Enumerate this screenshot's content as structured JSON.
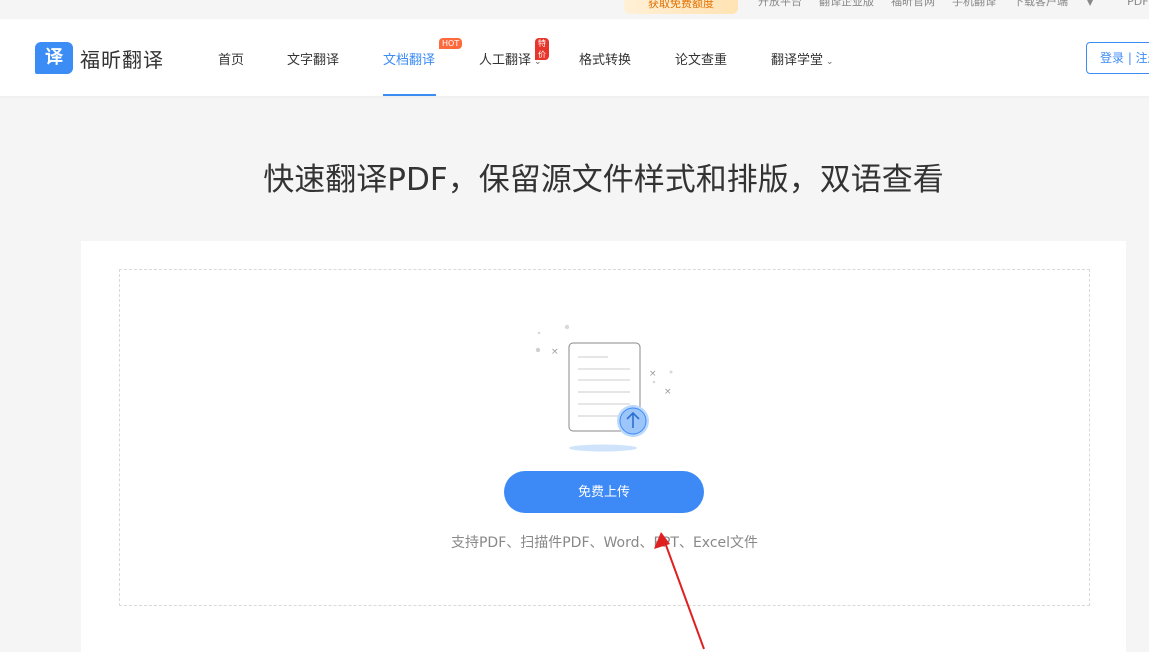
{
  "topbar": {
    "promo": "获取免费额度",
    "links": [
      "开放平台",
      "翻译企业版",
      "福昕官网",
      "手机翻译",
      "下载客户端",
      "PDF在线"
    ]
  },
  "header": {
    "logo_mark": "译",
    "logo_text": "福昕翻译",
    "nav": [
      {
        "label": "首页"
      },
      {
        "label": "文字翻译"
      },
      {
        "label": "文档翻译",
        "badge": "HOT",
        "active": true
      },
      {
        "label": "人工翻译",
        "badge": "特价",
        "dropdown": true
      },
      {
        "label": "格式转换"
      },
      {
        "label": "论文查重"
      },
      {
        "label": "翻译学堂",
        "dropdown": true
      }
    ],
    "login": "登录 | 注册"
  },
  "hero": {
    "title": "快速翻译PDF，保留源文件样式和排版，双语查看"
  },
  "upload": {
    "button": "免费上传",
    "support_text": "支持PDF、扫描件PDF、Word、PPT、Excel文件"
  },
  "colors": {
    "accent": "#3b8cf5",
    "hot_badge": "#ff6a3d",
    "special_badge": "#e8352b",
    "annotation_arrow": "#e02020"
  },
  "icons": [
    "document-upload-icon",
    "arrow-up-icon",
    "annotation-arrow"
  ]
}
